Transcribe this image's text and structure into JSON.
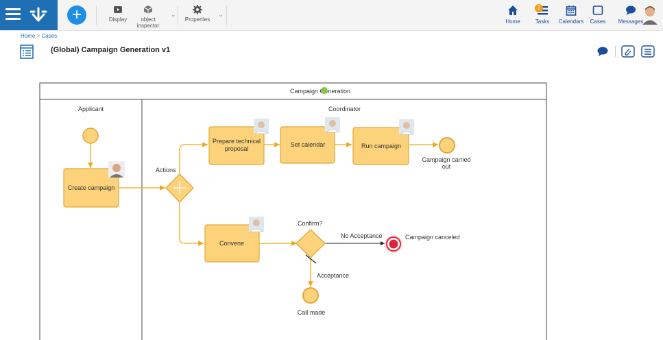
{
  "toolbar": {
    "display_label": "Display",
    "object_inspector_line1": "object",
    "object_inspector_line2": "inspector",
    "properties_label": "Properties"
  },
  "nav": {
    "home": "Home",
    "tasks": "Tasks",
    "tasks_badge": "2",
    "calendars": "Calendars",
    "cases": "Cases",
    "messages": "Messages"
  },
  "breadcrumb": {
    "home": "Home",
    "separator": ">",
    "cases": "Cases"
  },
  "page": {
    "title": "(Global) Campaign Generation v1"
  },
  "diagram": {
    "pool_title": "Campaign Generation",
    "lanes": [
      "Applicant",
      "Coordinator"
    ],
    "tasks": [
      "Create campaign",
      "Prepare technical",
      "proposal",
      "Set calendar",
      "Run campaign",
      "Convene"
    ],
    "gateways": {
      "actions": "Actions",
      "confirm": "Confirm?"
    },
    "flows": {
      "no_acceptance": "No Acceptance",
      "acceptance": "Acceptance"
    },
    "events": {
      "carried_out_1": "Campaign carried",
      "carried_out_2": "out",
      "canceled": "Campaign canceled",
      "call_made": "Call made"
    }
  },
  "colors": {
    "brand": "#1f6fb5",
    "task_fill": "#fcd27a",
    "task_stroke": "#e2a63a",
    "flow": "#f0a818",
    "end_red": "#d9263c",
    "status_green": "#8bc34a"
  }
}
